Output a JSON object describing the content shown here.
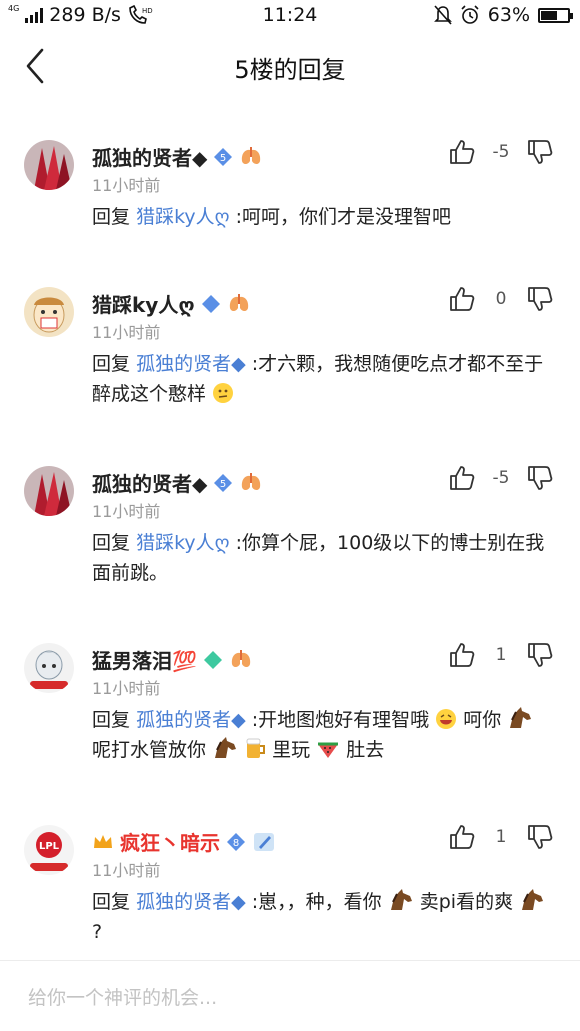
{
  "status": {
    "network": "4G",
    "speed": "289 B/s",
    "time": "11:24",
    "battery": "63%",
    "battery_level": 0.63
  },
  "nav": {
    "title": "5楼的回复"
  },
  "reply_label": "回复",
  "comments": [
    {
      "username": "孤独的贤者◆",
      "level": "5",
      "time": "11小时前",
      "votes": "-5",
      "mention": "猎踩ky人ღ",
      "text": ":呵呵，你们才是没理智吧"
    },
    {
      "username": "猎踩ky人ღ",
      "level": "",
      "time": "11小时前",
      "votes": "0",
      "mention": "孤独的贤者◆",
      "text": ":才六颗，我想随便吃点才都不至于醉成这个憨样"
    },
    {
      "username": "孤独的贤者◆",
      "level": "5",
      "time": "11小时前",
      "votes": "-5",
      "mention": "猎踩ky人ღ",
      "text": ":你算个屁，100级以下的博士别在我面前跳。"
    },
    {
      "username": "猛男落泪💯",
      "level": "",
      "time": "11小时前",
      "votes": "1",
      "mention": "孤独的贤者◆",
      "text_parts": [
        ":开地图炮好有理智哦",
        "呵你",
        "呢打水管放你",
        "里玩",
        "肚去"
      ]
    },
    {
      "username": "疯狂丶暗示",
      "level": "8",
      "time": "11小时前",
      "votes": "1",
      "mention": "孤独的贤者◆",
      "text_parts": [
        ":崽，，种，看你",
        "卖pi看的爽",
        "?"
      ]
    }
  ],
  "input": {
    "placeholder": "给你一个神评的机会..."
  },
  "colors": {
    "mention": "#4a7fd4",
    "time": "#9a9a9a",
    "vip_name": "#e8342e"
  }
}
